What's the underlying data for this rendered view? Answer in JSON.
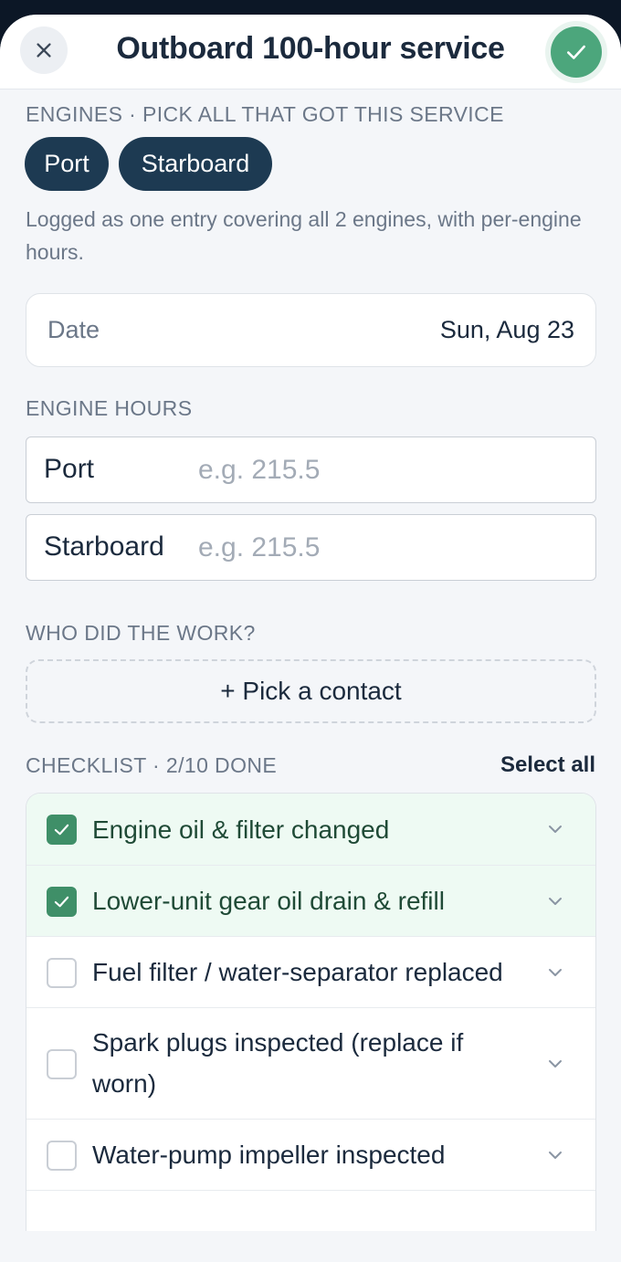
{
  "header": {
    "title": "Outboard 100-hour service",
    "close_icon": "close-icon",
    "save_icon": "checkmark-icon",
    "accent": "#4ca67c"
  },
  "engines": {
    "label": "ENGINES · PICK ALL THAT GOT THIS SERVICE",
    "chips": [
      "Port",
      "Starboard"
    ],
    "helper": "Logged as one entry covering all 2 engines, with per-engine hours."
  },
  "date": {
    "label": "Date",
    "value": "Sun, Aug 23"
  },
  "engine_hours": {
    "label": "ENGINE HOURS",
    "rows": [
      {
        "label": "Port",
        "placeholder": "e.g. 215.5",
        "value": ""
      },
      {
        "label": "Starboard",
        "placeholder": "e.g. 215.5",
        "value": ""
      }
    ]
  },
  "contact": {
    "label": "WHO DID THE WORK?",
    "button": "+ Pick a contact"
  },
  "checklist": {
    "label": "CHECKLIST · 2/10 DONE",
    "select_all": "Select all",
    "done_color": "#3f8f68",
    "items": [
      {
        "label": "Engine oil & filter changed",
        "checked": true
      },
      {
        "label": "Lower-unit gear oil drain & refill",
        "checked": true
      },
      {
        "label": "Fuel filter / water-separator replaced",
        "checked": false
      },
      {
        "label": "Spark plugs inspected (replace if worn)",
        "checked": false
      },
      {
        "label": "Water-pump impeller inspected",
        "checked": false
      }
    ]
  }
}
